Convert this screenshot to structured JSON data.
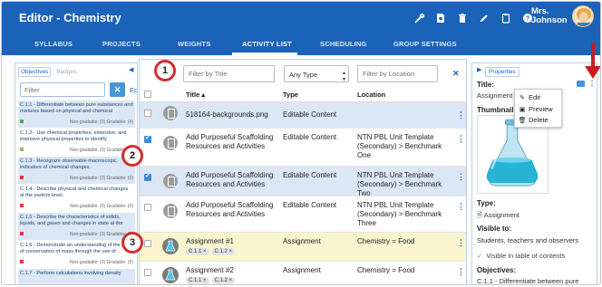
{
  "app": {
    "title": "Editor - Chemistry"
  },
  "user": {
    "name_line1": "Mrs.",
    "name_line2": "Johnson"
  },
  "tabs": [
    "SYLLABUS",
    "PROJECTS",
    "WEIGHTS",
    "ACTIVITY LIST",
    "SCHEDULING",
    "GROUP SETTINGS"
  ],
  "active_tab": "ACTIVITY LIST",
  "left_panel": {
    "tabs": [
      "Objectives",
      "Badges"
    ],
    "filter_placeholder": "Filter",
    "edit_label": "Edit",
    "objectives": [
      {
        "text": "C.1.1 - Differentiate between pure substances and mixtures based on physical and chemical",
        "meta": "Non-gradable: (0)   Gradable: (4)"
      },
      {
        "text": "C.1.2 - Use chemical properties, extensive, and intensive physical properties to identify",
        "meta": "Non-gradable: (0)   Gradable: (0)"
      },
      {
        "text": "C.1.3 - Recognize observable macroscopic indicators of chemical changes.",
        "meta": "Non-gradable: (0)   Gradable: (0)"
      },
      {
        "text": "C.1.4 - Describe physical and chemical changes at the particle level.",
        "meta": "Non-gradable: (0)   Gradable: (0)"
      },
      {
        "text": "C.1.5 - Describe the characteristics of solids, liquids, and gases and changes in state at the",
        "meta": "Non-gradable: (0)   Gradable: (0)"
      },
      {
        "text": "C.1.6 - Demonstrate an understanding of the law of conservation of mass through the use of",
        "meta": "Non-gradable: (0)   Gradable: (0)"
      },
      {
        "text": "C.1.7 - Perform calculations involving density",
        "meta": ""
      }
    ]
  },
  "filters": {
    "title_placeholder": "Filter by Title",
    "type_value": "Any Type",
    "location_placeholder": "Filter by Location"
  },
  "table": {
    "headers": {
      "title": "Title ▴",
      "type": "Type",
      "location": "Location"
    },
    "rows": [
      {
        "title": "518164-backgrounds.png",
        "type": "Editable Content",
        "location": "",
        "chips": []
      },
      {
        "title": "Add Purposeful Scaffolding Resources and Activities",
        "type": "Editable Content",
        "location": "NTN PBL Unit Template (Secondary) > Benchmark One",
        "chips": []
      },
      {
        "title": "Add Purposeful Scaffolding Resources and Activities",
        "type": "Editable Content",
        "location": "NTN PBL Unit Template (Secondary) > Benchmark Two",
        "chips": []
      },
      {
        "title": "Add Purposeful Scaffolding Resources and Activities",
        "type": "Editable Content",
        "location": "NTN PBL Unit Template (Secondary) > Benchmark Three",
        "chips": []
      },
      {
        "title": "Assignment #1",
        "type": "Assignment",
        "location": "Chemistry = Food",
        "chips": [
          "C.1.1 ×",
          "C.1.2 ×"
        ]
      },
      {
        "title": "Assignment #2",
        "type": "Assignment",
        "location": "Chemistry = Food",
        "chips": [
          "C.1.1 ×",
          "C.1.2 ×"
        ]
      }
    ]
  },
  "right_panel": {
    "tab": "Properties",
    "title_label": "Title:",
    "title_value": "Assignment #",
    "thumbnail_label": "Thumbnail:",
    "type_label": "Type:",
    "type_value": "Assignment",
    "visible_label": "Visible to:",
    "visible_value": "Students, teachers and observers",
    "toc_label": "Visible in table of contents",
    "objectives_label": "Objectives:",
    "objectives_value": "C.1.1 - Differentiate between pure"
  },
  "context_menu": {
    "items": [
      "Edit",
      "Preview",
      "Delete"
    ]
  },
  "callouts": [
    "1",
    "2",
    "3"
  ],
  "colors": {
    "header": "#1b63b9",
    "accent": "#3f8bd8",
    "highlight_row": "#fbf5cf",
    "selected_row": "#dbe7f5",
    "callout": "#d62c2c"
  }
}
